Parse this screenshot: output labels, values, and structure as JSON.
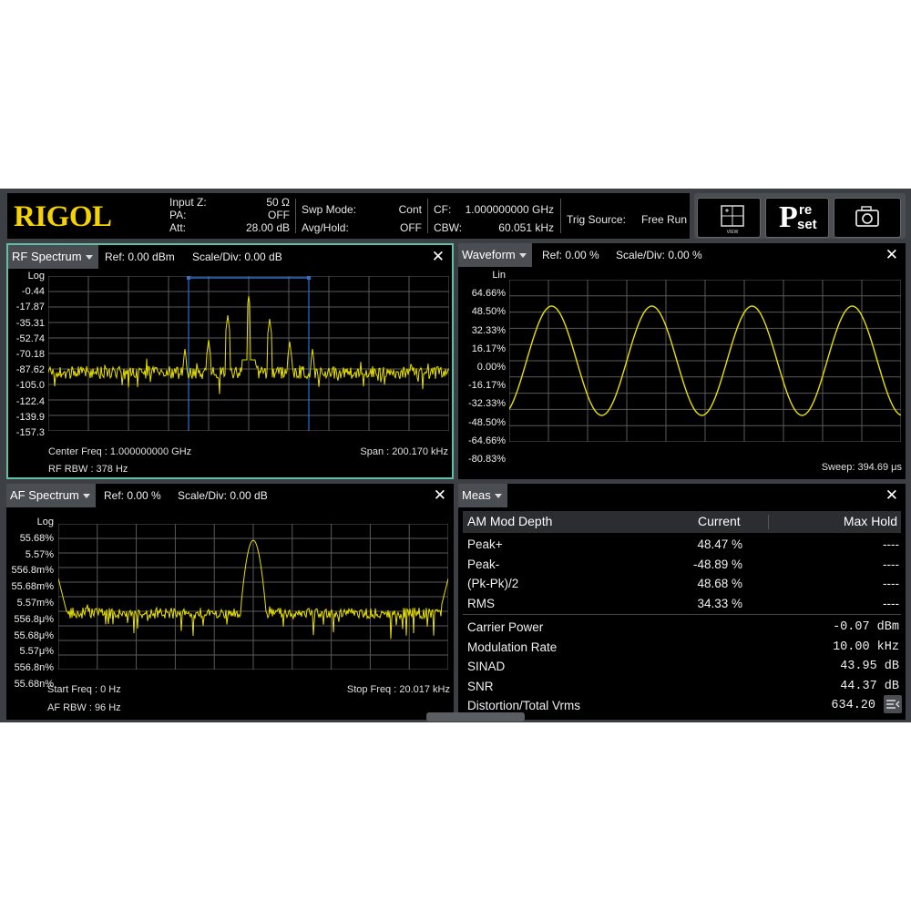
{
  "header": {
    "logo": "RIGOL",
    "input_z_label": "Input Z:",
    "input_z_value": "50 Ω",
    "pa_label": "PA:",
    "pa_value": "OFF",
    "att_label": "Att:",
    "att_value": "28.00 dB",
    "swp_mode_label": "Swp Mode:",
    "swp_mode_value": "Cont",
    "avg_hold_label": "Avg/Hold:",
    "avg_hold_value": "OFF",
    "cf_label": "CF:",
    "cf_value": "1.000000000 GHz",
    "cbw_label": "CBW:",
    "cbw_value": "60.051 kHz",
    "trig_label": "Trig Source:",
    "trig_value": "Free Run",
    "btn_view_icon": "view-add-icon",
    "btn_preset_big": "P",
    "btn_preset_small1": "re",
    "btn_preset_small2": "set",
    "btn_camera_icon": "camera-icon"
  },
  "rf": {
    "title": "RF Spectrum",
    "ref": "Ref: 0.00 dBm",
    "scale": "Scale/Div: 0.00 dB",
    "y_labels": [
      "Log",
      "-0.44",
      "-17.87",
      "-35.31",
      "-52.74",
      "-70.18",
      "-87.62",
      "-105.0",
      "-122.4",
      "-139.9",
      "-157.3"
    ],
    "center": "Center Freq : 1.000000000 GHz",
    "span": "Span : 200.170 kHz",
    "rbw": "RF RBW : 378 Hz"
  },
  "wave": {
    "title": "Waveform",
    "ref": "Ref: 0.00 %",
    "scale": "Scale/Div: 0.00 %",
    "y_labels": [
      "Lin",
      "64.66%",
      "48.50%",
      "32.33%",
      "16.17%",
      "0.00%",
      "-16.17%",
      "-32.33%",
      "-48.50%",
      "-64.66%",
      "-80.83%"
    ],
    "sweep": "Sweep:  394.69 μs"
  },
  "af": {
    "title": "AF Spectrum",
    "ref": "Ref: 0.00 %",
    "scale": "Scale/Div: 0.00 dB",
    "y_labels": [
      "Log",
      "55.68%",
      "5.57%",
      "556.8m%",
      "55.68m%",
      "5.57m%",
      "556.8μ%",
      "55.68μ%",
      "5.57μ%",
      "556.8n%",
      "55.68n%"
    ],
    "start": "Start Freq : 0 Hz",
    "stop": "Stop Freq : 20.017 kHz",
    "rbw": "AF RBW : 96 Hz"
  },
  "meas": {
    "title": "Meas",
    "headers": [
      "AM Mod Depth",
      "Current",
      "Max Hold"
    ],
    "rows": [
      {
        "name": "Peak+",
        "current": "48.47 %",
        "max": "----"
      },
      {
        "name": "Peak-",
        "current": "-48.89 %",
        "max": "----"
      },
      {
        "name": "(Pk-Pk)/2",
        "current": "48.68 %",
        "max": "----"
      },
      {
        "name": "RMS",
        "current": "34.33 %",
        "max": "----"
      }
    ],
    "rows2": [
      {
        "name": "Carrier Power",
        "value": "-0.07 dBm"
      },
      {
        "name": "Modulation Rate",
        "value": "10.00 kHz"
      },
      {
        "name": "SINAD",
        "value": "43.95 dB"
      },
      {
        "name": "SNR",
        "value": "44.37 dB"
      },
      {
        "name": "Distortion/Total Vrms",
        "value": "634.20"
      }
    ]
  },
  "colors": {
    "trace": "#e8e000",
    "grid": "#5a5a5a",
    "marker": "#2f6fd0",
    "active_border": "#5fc0a5"
  }
}
